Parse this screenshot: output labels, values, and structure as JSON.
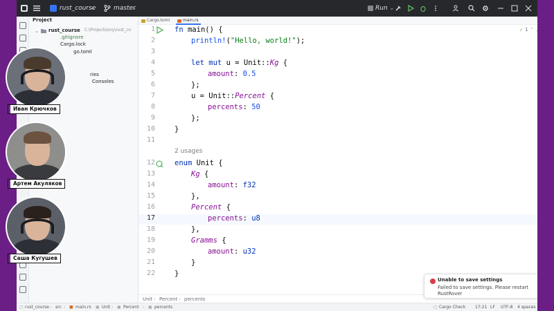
{
  "titlebar": {
    "project": "rust_course",
    "branch": "master",
    "run_label": "Run"
  },
  "project_panel": {
    "header": "Project",
    "root_name": "rust_course",
    "root_path": "C:\\Projects\\my\\rust_co",
    "files": [
      ".gitignore",
      "Cargo.lock",
      "go.toml"
    ],
    "partial_items": [
      "ries",
      "Consoles"
    ]
  },
  "tabs": [
    {
      "label": "Cargo.toml",
      "active": false
    },
    {
      "label": "main.rs",
      "active": true
    }
  ],
  "editor": {
    "line_numbers": [
      "1",
      "2",
      "3",
      "4",
      "5",
      "6",
      "7",
      "8",
      "9",
      "10",
      "11",
      "12",
      "13",
      "14",
      "15",
      "16",
      "17",
      "18",
      "19",
      "20",
      "21",
      "22"
    ],
    "current_line": "17",
    "usages_hint": "2 usages",
    "inspection_count": "1",
    "code": {
      "l1_kw": "fn",
      "l1_rest": " main() {",
      "l2_macro": "println!",
      "l2_open": "(",
      "l2_str": "\"Hello, world!\"",
      "l2_close": ");",
      "l4_kw": "let mut",
      "l4_rest": " u = Unit::",
      "l4_variant": "Kg",
      "l4_brace": " {",
      "l5_field": "amount",
      "l5_colon": ": ",
      "l5_val": "0.5",
      "l6": "};",
      "l7_a": "u = Unit::",
      "l7_variant": "Percent",
      "l7_brace": " {",
      "l8_field": "percents",
      "l8_colon": ": ",
      "l8_val": "50",
      "l9": "};",
      "l10": "}",
      "l12_kw": "enum",
      "l12_rest": " Unit {",
      "l13_variant": "Kg",
      "l13_brace": " {",
      "l14_field": "amount",
      "l14_colon": ": ",
      "l14_type": "f32",
      "l15": "},",
      "l16_variant": "Percent",
      "l16_brace": " {",
      "l17_field": "percents",
      "l17_colon": ": ",
      "l17_type": "u8",
      "l18": "},",
      "l19_variant": "Gramms",
      "l19_brace": " {",
      "l20_field": "amount",
      "l20_colon": ": ",
      "l20_type": "u32",
      "l21": "}",
      "l22": "}"
    }
  },
  "breadcrumbs": [
    "Unit",
    "Percent",
    "percents"
  ],
  "status": {
    "path": [
      "rust_course",
      "src",
      "main.rs",
      "Unit",
      "Percent",
      "percents"
    ],
    "cargo_check": "Cargo Check",
    "position": "17:21",
    "line_sep": "LF",
    "encoding": "UTF-8",
    "indent": "4 spaces"
  },
  "notification": {
    "title": "Unable to save settings",
    "body": "Failed to save settings. Please restart RustRover"
  },
  "participants": [
    {
      "name": "Иван Крючков"
    },
    {
      "name": "Артем Акуляков"
    },
    {
      "name": "Саша Кугушев"
    }
  ],
  "colors": {
    "keyword": "#0033b3",
    "string": "#067d17",
    "number": "#1750eb",
    "field": "#871094",
    "frame_bg": "#6b1e86",
    "error": "#db3b4b"
  }
}
